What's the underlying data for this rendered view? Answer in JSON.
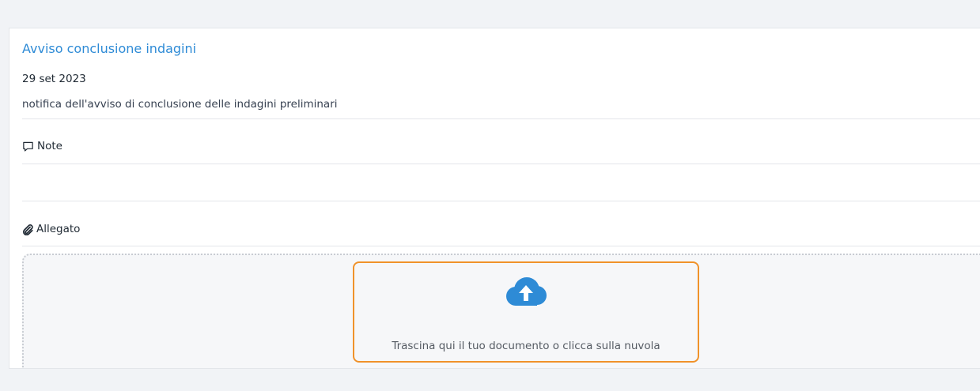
{
  "card": {
    "title": "Avviso conclusione indagini",
    "date": "29 set 2023",
    "description": "notifica dell'avviso di conclusione delle indagini preliminari"
  },
  "notes": {
    "label": "Note",
    "icon": "comment-icon",
    "value": ""
  },
  "attachment": {
    "label": "Allegato",
    "icon": "paperclip-icon",
    "dropzone_text": "Trascina qui il tuo documento o clicca sulla nuvola",
    "upload_icon": "cloud-upload-icon"
  },
  "colors": {
    "title": "#2e8bd6",
    "cloud": "#2e8bd6",
    "highlight": "#f0922a",
    "background": "#f1f3f6"
  }
}
